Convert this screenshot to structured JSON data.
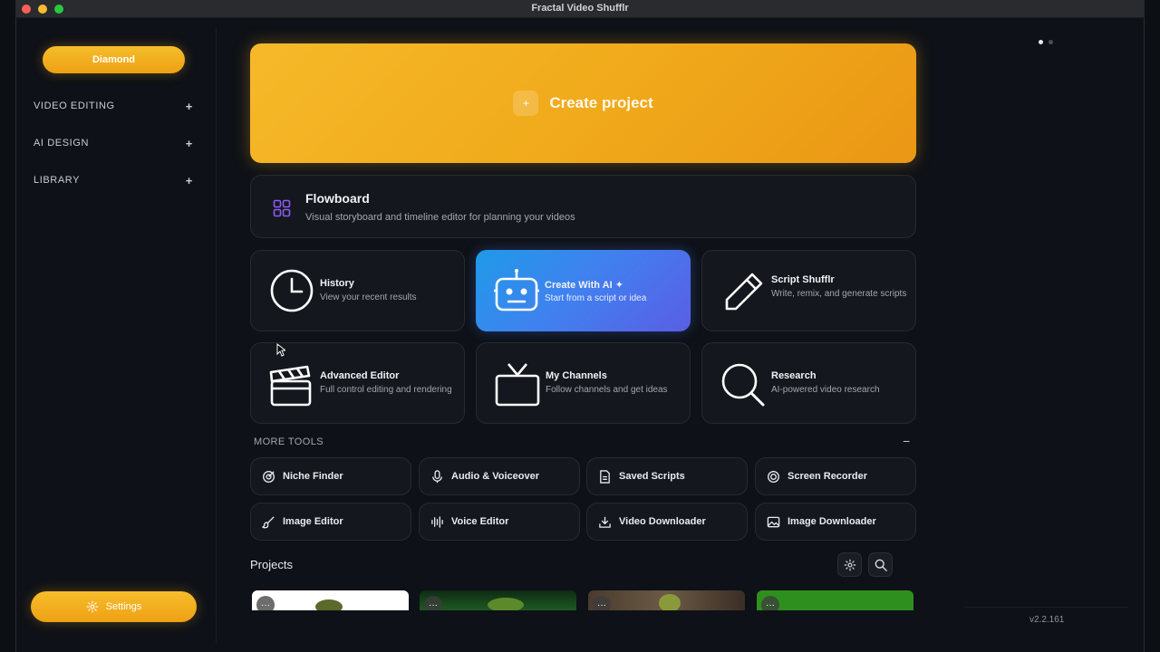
{
  "window": {
    "title": "Fractal Video Shufflr"
  },
  "sidebar": {
    "plan": "Diamond",
    "sections": [
      {
        "label": "VIDEO EDITING",
        "toggle": "+"
      },
      {
        "label": "AI DESIGN",
        "toggle": "+"
      },
      {
        "label": "LIBRARY",
        "toggle": "+"
      }
    ],
    "settings": "Settings"
  },
  "create_project": {
    "label": "Create project",
    "icon": "plus-icon"
  },
  "flowboard": {
    "title": "Flowboard",
    "subtitle": "Visual storyboard and timeline editor for planning your videos",
    "icon": "grid-icon"
  },
  "cards": [
    {
      "title": "History",
      "subtitle": "View your recent results",
      "icon": "clock-icon"
    },
    {
      "title": "Create With AI ✦",
      "subtitle": "Start from a script or idea",
      "icon": "robot-icon"
    },
    {
      "title": "Script Shufflr",
      "subtitle": "Write, remix, and generate scripts",
      "icon": "pencil-icon"
    },
    {
      "title": "Advanced Editor",
      "subtitle": "Full control editing and rendering",
      "icon": "clapperboard-icon"
    },
    {
      "title": "My Channels",
      "subtitle": "Follow channels and get ideas",
      "icon": "tv-icon"
    },
    {
      "title": "Research",
      "subtitle": "AI-powered video research",
      "icon": "magnifier-icon"
    }
  ],
  "more_tools": {
    "label": "MORE TOOLS",
    "toggle": "−",
    "items": [
      {
        "label": "Niche Finder",
        "icon": "target-icon"
      },
      {
        "label": "Audio & Voiceover",
        "icon": "microphone-icon"
      },
      {
        "label": "Saved Scripts",
        "icon": "document-icon"
      },
      {
        "label": "Screen Recorder",
        "icon": "record-icon"
      },
      {
        "label": "Image Editor",
        "icon": "brush-icon"
      },
      {
        "label": "Voice Editor",
        "icon": "waveform-icon"
      },
      {
        "label": "Video Downloader",
        "icon": "download-icon"
      },
      {
        "label": "Image Downloader",
        "icon": "image-icon"
      }
    ]
  },
  "projects": {
    "title": "Projects",
    "thumbnails": [
      {
        "menu": "···",
        "color": "#ffffff"
      },
      {
        "menu": "···",
        "color": "#1f5a24"
      },
      {
        "menu": "···",
        "color": "#5a4a3a"
      },
      {
        "menu": "···",
        "color": "#2f8f1e"
      }
    ]
  },
  "colors": {
    "accent": "#f0a91a",
    "ai_gradient_start": "#1f9ae8",
    "ai_gradient_end": "#5a5ee6"
  },
  "version": "v2.2.161"
}
